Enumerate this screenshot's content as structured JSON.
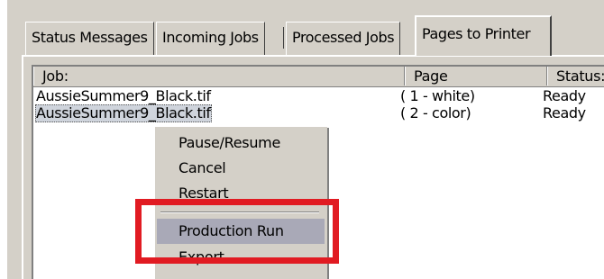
{
  "tabs": [
    {
      "label": "Status Messages",
      "active": false
    },
    {
      "label": "Incoming Jobs",
      "active": false
    },
    {
      "label": "Processed Jobs",
      "active": false
    },
    {
      "label": "Pages to Printer",
      "active": true
    }
  ],
  "list": {
    "columns": [
      "Job:",
      "Page",
      "Status:"
    ],
    "rows": [
      {
        "job": "AussieSummer9_Black.tif",
        "page": "( 1 - white)",
        "status": "Ready",
        "selected": false
      },
      {
        "job": "AussieSummer9_Black.tif",
        "page": "( 2 - color)",
        "status": "Ready",
        "selected": true
      }
    ]
  },
  "context_menu": {
    "items": [
      {
        "label": "Pause/Resume"
      },
      {
        "label": "Cancel"
      },
      {
        "label": "Restart"
      },
      {
        "label": "Production Run",
        "hovered": true
      },
      {
        "label": "Export"
      }
    ]
  },
  "annotation": {
    "highlight_color": "#e11b22",
    "target": "Production Run"
  },
  "colors": {
    "window_face": "#d4d0c8",
    "menu_hover": "#a9a9b7",
    "selection": "#cfd4dc"
  }
}
